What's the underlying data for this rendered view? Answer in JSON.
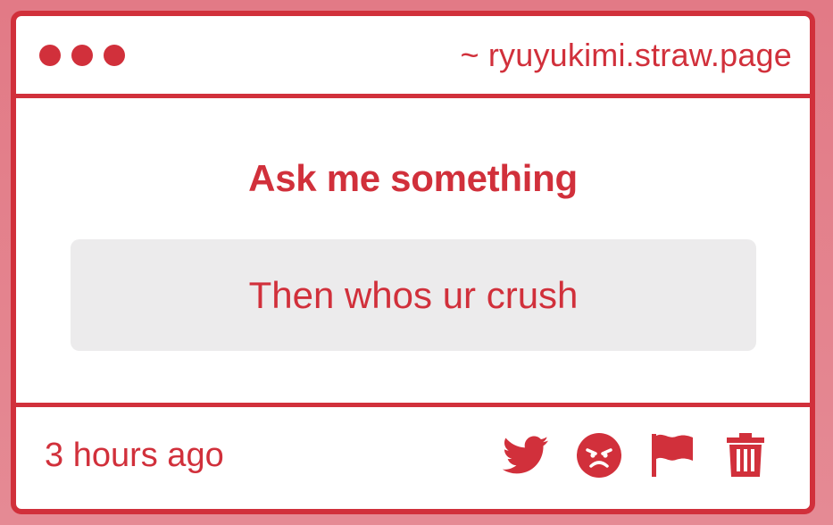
{
  "window": {
    "site": "~ ryuyukimi.straw.page"
  },
  "main": {
    "heading": "Ask me something",
    "question": "Then whos ur crush"
  },
  "footer": {
    "timestamp": "3 hours ago",
    "actions": [
      "twitter-icon",
      "angry-face-icon",
      "flag-icon",
      "trash-icon"
    ]
  },
  "colors": {
    "accent": "#d1303b",
    "question_bg": "#ecebec",
    "page_bg": "#e27a86"
  }
}
